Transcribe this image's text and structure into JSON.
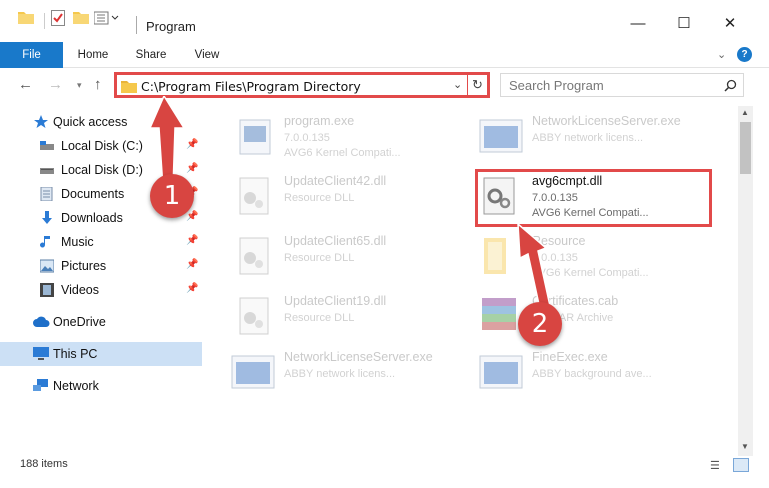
{
  "window": {
    "title": "Program",
    "minimize": "—",
    "maximize": "☐",
    "close": "✕"
  },
  "ribbon": {
    "file": "File",
    "home": "Home",
    "share": "Share",
    "view": "View"
  },
  "address": {
    "path": "C:\\Program Files\\Program Directory"
  },
  "search": {
    "placeholder": "Search Program"
  },
  "sidebar": {
    "items": [
      {
        "label": "Quick access",
        "icon": "star-icon"
      },
      {
        "label": "Local Disk (C:)",
        "icon": "drive-icon",
        "pinned": true
      },
      {
        "label": "Local Disk (D:)",
        "icon": "drive-icon",
        "pinned": true
      },
      {
        "label": "Documents",
        "icon": "documents-icon",
        "pinned": true
      },
      {
        "label": "Downloads",
        "icon": "downloads-icon",
        "pinned": true
      },
      {
        "label": "Music",
        "icon": "music-icon",
        "pinned": true
      },
      {
        "label": "Pictures",
        "icon": "pictures-icon",
        "pinned": true
      },
      {
        "label": "Videos",
        "icon": "videos-icon",
        "pinned": true
      },
      {
        "label": "OneDrive",
        "icon": "cloud-icon"
      },
      {
        "label": "This PC",
        "icon": "monitor-icon",
        "selected": true
      },
      {
        "label": "Network",
        "icon": "network-icon"
      }
    ]
  },
  "files": [
    {
      "name": "program.exe",
      "line2": "7.0.0.135",
      "line3": "AVG6 Kernel Compati..."
    },
    {
      "name": "NetworkLicenseServer.exe",
      "line2": "ABBY network licens...",
      "line3": ""
    },
    {
      "name": "UpdateClient42.dll",
      "line2": "Resource DLL",
      "line3": ""
    },
    {
      "name": "avg6cmpt.dll",
      "line2": "7.0.0.135",
      "line3": "AVG6 Kernel Compati..."
    },
    {
      "name": "UpdateClient65.dll",
      "line2": "Resource DLL",
      "line3": ""
    },
    {
      "name": "Resource",
      "line2": "7.0.0.135",
      "line3": "AVG6 Kernel Compati..."
    },
    {
      "name": "UpdateClient19.dll",
      "line2": "Resource DLL",
      "line3": ""
    },
    {
      "name": "Certificates.cab",
      "line2": "WinRAR Archive",
      "line3": ""
    },
    {
      "name": "NetworkLicenseServer.exe",
      "line2": "ABBY network licens...",
      "line3": ""
    },
    {
      "name": "FineExec.exe",
      "line2": "ABBY background ave...",
      "line3": ""
    }
  ],
  "callouts": {
    "one": "1",
    "two": "2"
  },
  "status": {
    "count": "188 items"
  }
}
